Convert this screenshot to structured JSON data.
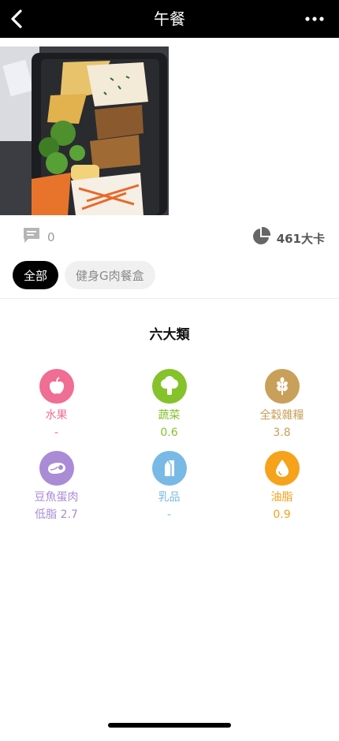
{
  "nav": {
    "title": "午餐"
  },
  "meta": {
    "comment_count": "0",
    "calories": "461大卡"
  },
  "filters": [
    {
      "label": "全部",
      "active": true
    },
    {
      "label": "健身G肉餐盒",
      "active": false
    }
  ],
  "section": {
    "title": "六大類"
  },
  "categories": [
    {
      "name": "水果",
      "amount": "-",
      "color": "#f06d93",
      "icon": "apple-icon"
    },
    {
      "name": "蔬菜",
      "amount": "0.6",
      "color": "#86c22a",
      "icon": "broccoli-icon"
    },
    {
      "name": "全穀雜糧",
      "amount": "3.8",
      "color": "#c9a05a",
      "icon": "wheat-icon"
    },
    {
      "name": "豆魚蛋肉",
      "amount": "低脂 2.7",
      "color": "#a98bd6",
      "icon": "meat-icon"
    },
    {
      "name": "乳品",
      "amount": "-",
      "color": "#78b9e6",
      "icon": "milk-carton-icon"
    },
    {
      "name": "油脂",
      "amount": "0.9",
      "color": "#f6a21a",
      "icon": "oil-drop-icon"
    }
  ],
  "colors": {
    "nav_bg": "#000000",
    "chip_active_bg": "#000000",
    "chip_inactive_bg": "#f0f0f0"
  }
}
